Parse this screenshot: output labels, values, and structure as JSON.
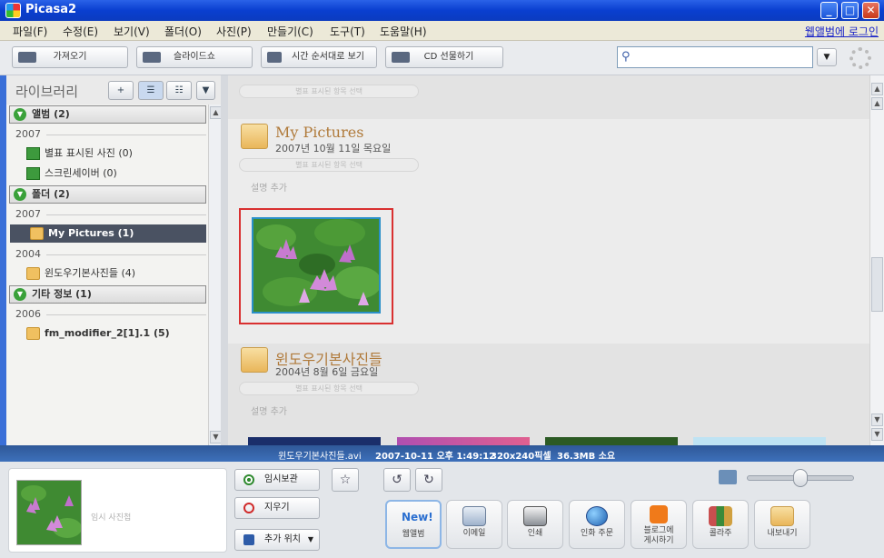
{
  "window": {
    "title": "Picasa2",
    "min": "_",
    "max": "□",
    "close": "✕"
  },
  "menu": {
    "items": [
      "파일(F)",
      "수정(E)",
      "보기(V)",
      "폴더(O)",
      "사진(P)",
      "만들기(C)",
      "도구(T)",
      "도움말(H)"
    ],
    "login": "웹앨범에 로그인"
  },
  "toolbar": {
    "import": "가져오기",
    "slideshow": "슬라이드쇼",
    "timeline": "시간 순서대로 보기",
    "cd": "CD 선물하기",
    "search_icon": "search-icon",
    "search_dropdown": "▼"
  },
  "library": {
    "title": "라이브러리",
    "add_label": "+",
    "sections": [
      {
        "label": "앨범",
        "count": "(2)"
      },
      {
        "label": "폴더",
        "count": "(2)"
      },
      {
        "label": "기타 정보",
        "count": "(1)"
      }
    ],
    "years": [
      "2007",
      "2007",
      "2004",
      "2006"
    ],
    "items": [
      {
        "label": "별표 표시된 사진 (0)"
      },
      {
        "label": "스크린세이버 (0)"
      },
      {
        "label": "My Pictures (1)"
      },
      {
        "label": "윈도우기본사진들 (4)"
      },
      {
        "label": "fm_modifier_2[1].1 (5)"
      }
    ]
  },
  "main": {
    "top_pill": "별표 표시된 항목 선택",
    "folders": [
      {
        "title": "My Pictures",
        "date": "2007년 10월 11일 목요일",
        "pill": "별표 표시된 항목 선택",
        "desc": "설명 추가"
      },
      {
        "title": "윈도우기본사진들",
        "date": "2004년 8월 6일 금요일",
        "pill": "별표 표시된 항목 선택",
        "desc": "설명 추가"
      }
    ]
  },
  "status": {
    "filename": "윈도우기본사진들.avi",
    "datetime": "2007-10-11 오후 1:49:12",
    "dimensions": "320x240픽셀",
    "size": "36.3MB 소요"
  },
  "bottom": {
    "tray_label": "임시 사진첩",
    "hold": "임시보관",
    "clear": "지우기",
    "add_to": "추가 위치",
    "actions": [
      {
        "label": "웹앨범",
        "icon": "new-badge-icon"
      },
      {
        "label": "이메일",
        "icon": "email-icon"
      },
      {
        "label": "인쇄",
        "icon": "printer-icon"
      },
      {
        "label": "인화 주문",
        "icon": "globe-icon"
      },
      {
        "label": "블로그에 게시하기",
        "icon": "blogger-icon"
      },
      {
        "label": "콜라주",
        "icon": "collage-icon"
      },
      {
        "label": "내보내기",
        "icon": "export-folder-icon"
      }
    ],
    "new_badge": "New!"
  },
  "colors": {
    "title_bar": "#0a3fd0",
    "selection": "#4a5262",
    "highlight_frame": "#d93030",
    "status_bar": "#2f5898"
  }
}
